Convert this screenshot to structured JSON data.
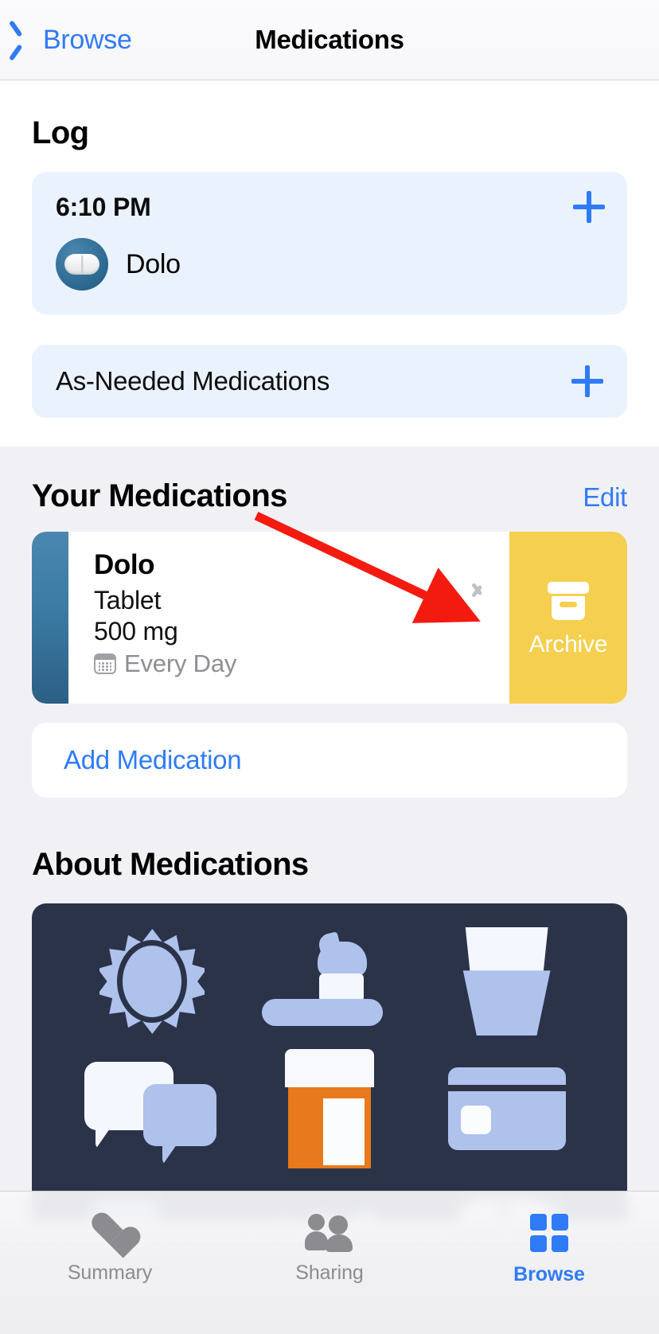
{
  "nav": {
    "back_label": "Browse",
    "title": "Medications"
  },
  "log": {
    "section_title": "Log",
    "entry": {
      "time": "6:10 PM",
      "medication_name": "Dolo",
      "add_label": "+"
    },
    "as_needed": {
      "label": "As-Needed Medications",
      "add_label": "+"
    }
  },
  "your_medications": {
    "section_title": "Your Medications",
    "edit_label": "Edit",
    "items": [
      {
        "name": "Dolo",
        "form": "Tablet",
        "dose": "500 mg",
        "schedule": "Every Day",
        "swipe_action_label": "Archive"
      }
    ],
    "add_medication_label": "Add Medication"
  },
  "about": {
    "section_title": "About Medications"
  },
  "tabbar": {
    "tabs": [
      {
        "label": "Summary",
        "active": false
      },
      {
        "label": "Sharing",
        "active": false
      },
      {
        "label": "Browse",
        "active": true
      }
    ]
  },
  "colors": {
    "accent_blue": "#2f7bf6",
    "archive_yellow": "#f5cf4f",
    "log_card_blue": "#eaf2fd",
    "gray_background": "#f1f1f5",
    "illustration_navy": "#2b3349",
    "pill_bottle_orange": "#e8791d",
    "med_accent_bar": "#3b7ba4"
  }
}
